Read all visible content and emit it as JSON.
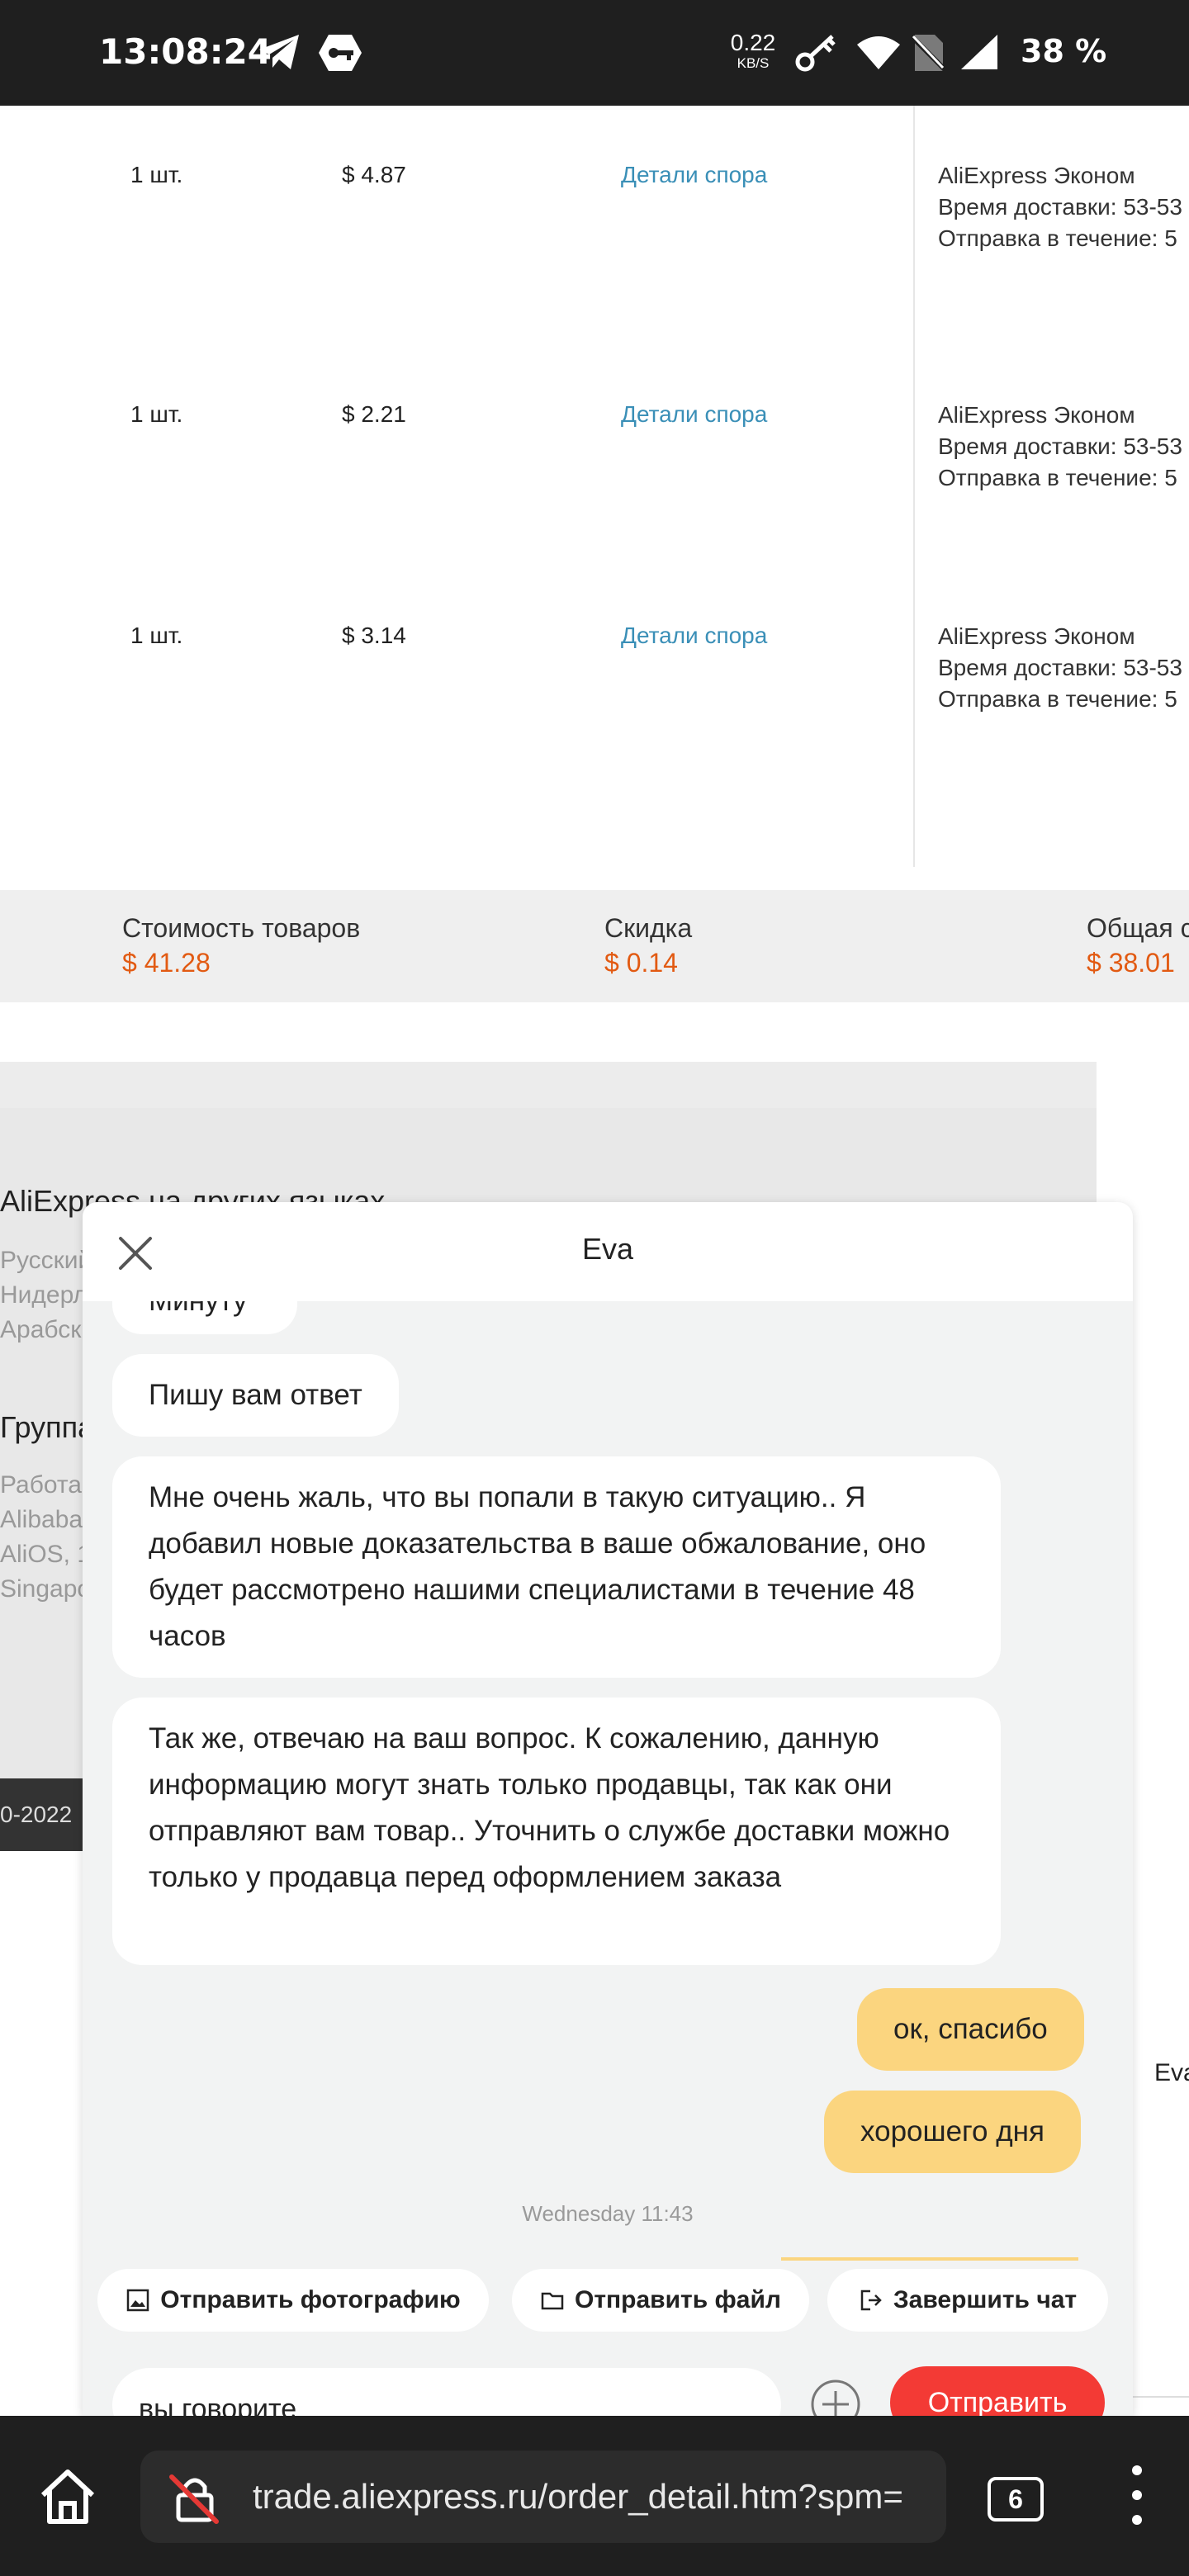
{
  "status_bar": {
    "time": "13:08:24",
    "net_speed": "0.22",
    "net_unit": "KB/S",
    "battery": "38 %"
  },
  "order_rows": [
    {
      "qty": "1 шт.",
      "price": "$ 4.87",
      "dispute_link": "Детали спора",
      "shipping_method": "AliExpress Эконом",
      "delivery_time": "Время доставки: 53-53",
      "dispatch": "Отправка в течение: 5"
    },
    {
      "qty": "1 шт.",
      "price": "$ 2.21",
      "dispute_link": "Детали спора",
      "shipping_method": "AliExpress Эконом",
      "delivery_time": "Время доставки: 53-53",
      "dispatch": "Отправка в течение: 5"
    },
    {
      "qty": "1 шт.",
      "price": "$ 3.14",
      "dispute_link": "Детали спора",
      "shipping_method": "AliExpress Эконом",
      "delivery_time": "Время доставки: 53-53",
      "dispatch": "Отправка в течение: 5"
    }
  ],
  "summary": {
    "goods_label": "Стоимость товаров",
    "goods_value": "$ 41.28",
    "discount_label": "Скидка",
    "discount_value": "$ 0.14",
    "total_label": "Общая с",
    "total_value": "$ 38.01"
  },
  "footer": {
    "languages_heading": "AliExpress на других языках",
    "languages": [
      "Русский",
      "Нидерл",
      "Арабск"
    ],
    "group_heading": "Группа",
    "group_items": [
      "Работа",
      "Alibaba",
      "AliOS, 1",
      "Singapo"
    ],
    "copyright": "0-2022"
  },
  "chat": {
    "title": "Eva",
    "messages": [
      {
        "from": "agent",
        "text": "Минуту"
      },
      {
        "from": "agent",
        "text": "Пишу вам ответ"
      },
      {
        "from": "agent",
        "text": "Мне очень жаль, что вы попали в такую ситуацию.. Я добавил новые доказательства в ваше обжалование, оно будет рассмотрено нашими специалистами в течение 48 часов"
      },
      {
        "from": "agent",
        "text": "Так же, отвечаю на ваш вопрос. К сожалению, данную информацию могут знать только продавцы, так как они отправляют вам товар.. Уточнить о службе доставки можно только у продавца перед оформлением заказа"
      },
      {
        "from": "user",
        "text": "ок, спасибо"
      },
      {
        "from": "user",
        "text": "хорошего дня"
      }
    ],
    "timestamp": "Wednesday 11:43",
    "quick_actions": {
      "send_photo": "Отправить фотографию",
      "send_file": "Отправить файл",
      "end_chat": "Завершить чат"
    },
    "input_value": "вы говорите",
    "send_label": "Отправить",
    "side_label": "Eva"
  },
  "browser": {
    "url": "trade.aliexpress.ru/order_detail.htm?spm=",
    "tab_count": "6"
  },
  "colors": {
    "accent_orange": "#e25a12",
    "link_blue": "#3a8fb7",
    "user_bubble": "#fbd57f",
    "send_button": "#f33a35"
  }
}
